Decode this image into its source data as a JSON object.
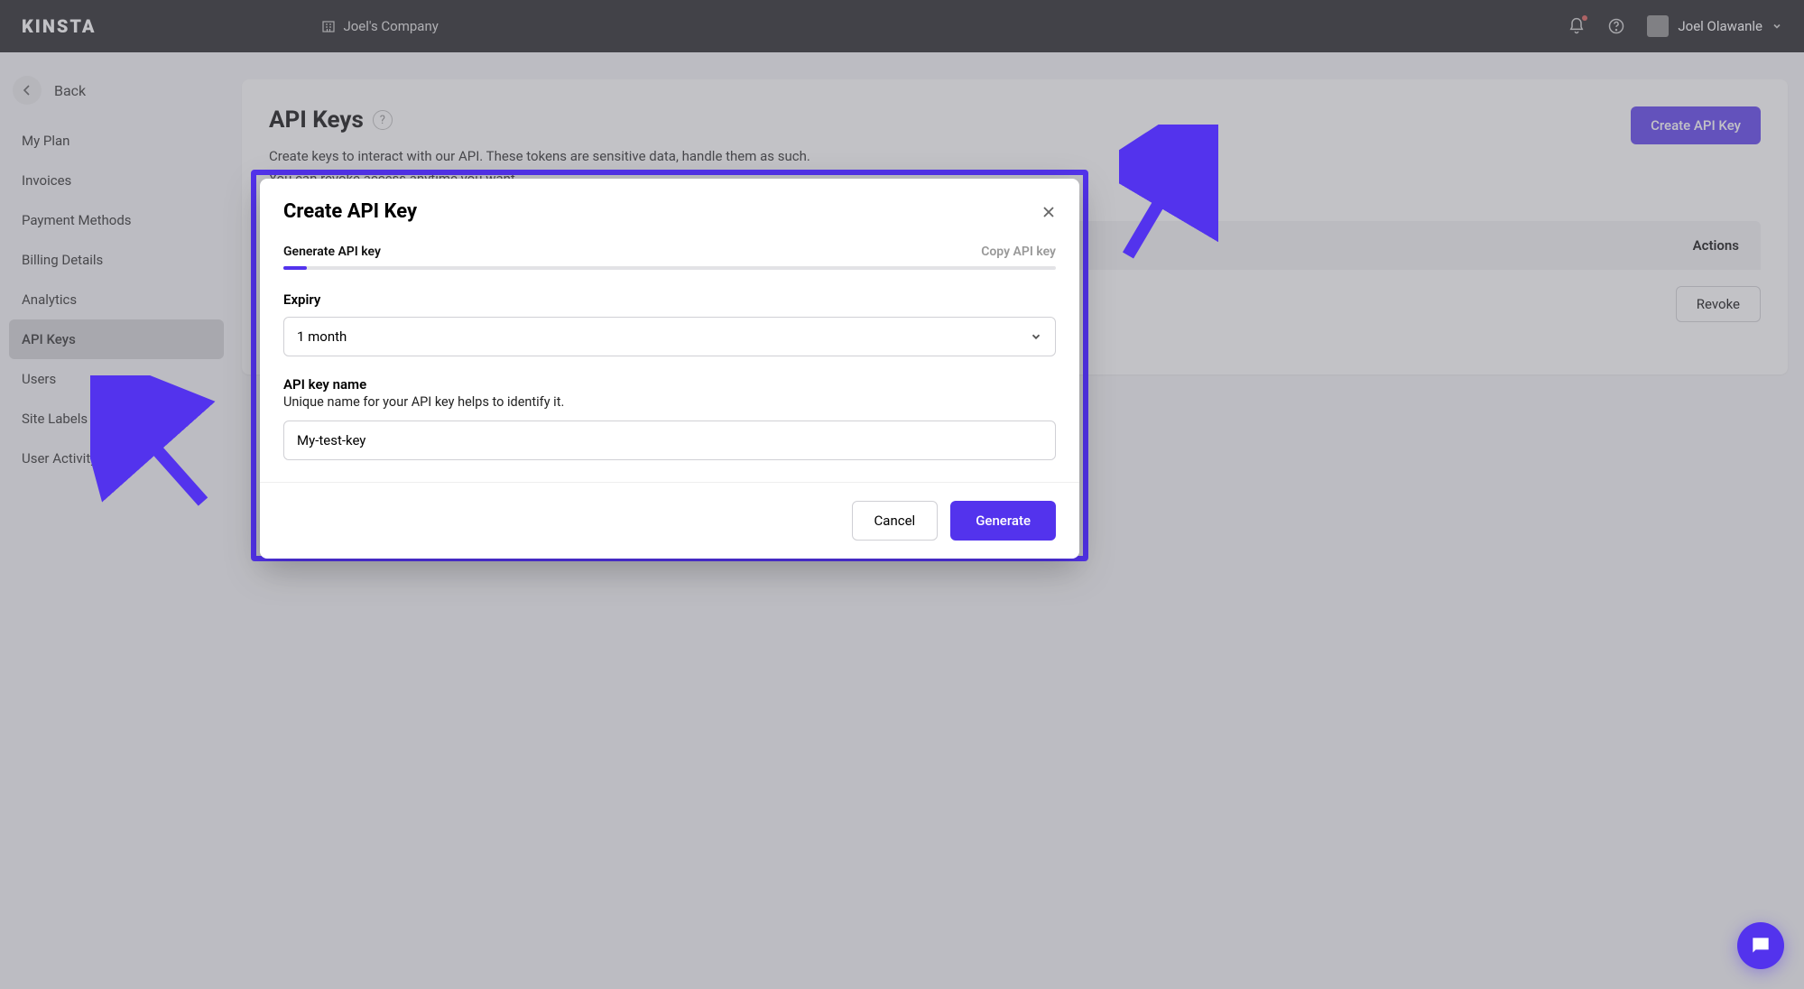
{
  "topbar": {
    "logo": "KINSTA",
    "company": "Joel's Company",
    "username": "Joel Olawanle"
  },
  "sidebar": {
    "back_label": "Back",
    "items": [
      {
        "label": "My Plan"
      },
      {
        "label": "Invoices"
      },
      {
        "label": "Payment Methods"
      },
      {
        "label": "Billing Details"
      },
      {
        "label": "Analytics"
      },
      {
        "label": "API Keys"
      },
      {
        "label": "Users"
      },
      {
        "label": "Site Labels"
      },
      {
        "label": "User Activity"
      }
    ],
    "active_index": 5
  },
  "page": {
    "title": "API Keys",
    "desc_line1": "Create keys to interact with our API. These tokens are sensitive data, handle them as such.",
    "desc_line2": "You can revoke access anytime you want.",
    "create_button": "Create API Key",
    "table_actions_header": "Actions",
    "revoke_button": "Revoke"
  },
  "modal": {
    "title": "Create API Key",
    "step1_label": "Generate API key",
    "step2_label": "Copy API key",
    "expiry_label": "Expiry",
    "expiry_value": "1 month",
    "name_label": "API key name",
    "name_hint": "Unique name for your API key helps to identify it.",
    "name_value": "My-test-key",
    "cancel_label": "Cancel",
    "generate_label": "Generate"
  },
  "colors": {
    "accent": "#5333ed"
  }
}
